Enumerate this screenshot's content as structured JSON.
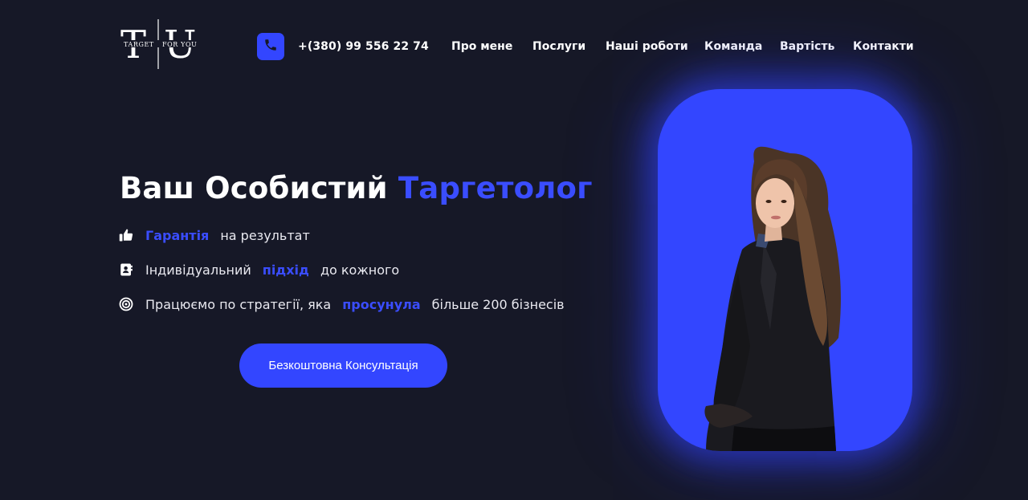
{
  "brand": {
    "logo_letters": "TFU",
    "logo_subtitle": "TARGET FOR YOU"
  },
  "header": {
    "phone_icon": "phone-icon",
    "phone_number": "+(380) 99 556 22 74",
    "nav": [
      {
        "label": "Про мене"
      },
      {
        "label": "Послуги"
      },
      {
        "label": "Наші роботи"
      },
      {
        "label": "Команда"
      },
      {
        "label": "Вартість"
      },
      {
        "label": "Контакти"
      }
    ]
  },
  "hero": {
    "title_main": "Ваш Особистий",
    "title_accent": "Таргетолог",
    "features": [
      {
        "icon": "thumbs-up-icon",
        "before": "",
        "highlight": "Гарантія",
        "after": "на результат"
      },
      {
        "icon": "contact-card-icon",
        "before": "Індивідуальний",
        "highlight": "підхід",
        "after": "до кожного"
      },
      {
        "icon": "target-icon",
        "before": "Працюємо по стратегії, яка",
        "highlight": "просунула",
        "after": "більше 200 бізнесів"
      }
    ],
    "cta_label": "Безкоштовна Консультація"
  },
  "colors": {
    "background": "#161827",
    "accent": "#3346ff",
    "accent_text": "#3a4dff",
    "text": "#ffffff"
  }
}
